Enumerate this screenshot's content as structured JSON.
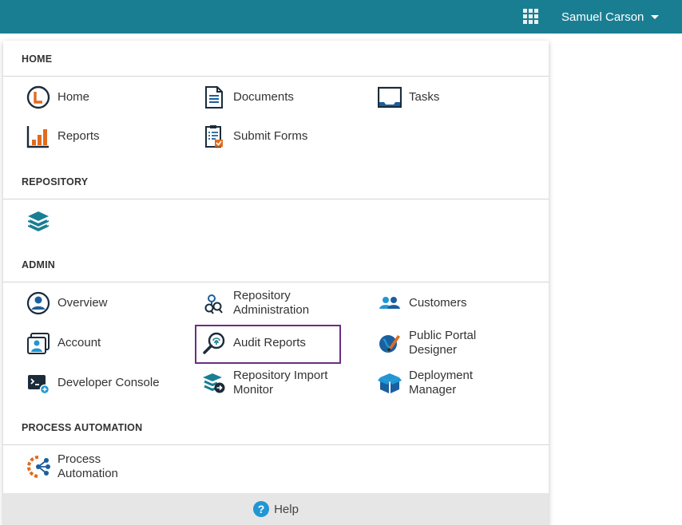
{
  "header": {
    "user_name": "Samuel Carson",
    "apps_icon": "apps-grid-icon",
    "bar_color": "#1a7e93"
  },
  "menu": {
    "sections": {
      "home": {
        "title": "HOME",
        "items": [
          {
            "label": "Home",
            "icon": "home-icon"
          },
          {
            "label": "Documents",
            "icon": "documents-icon"
          },
          {
            "label": "Tasks",
            "icon": "tasks-icon"
          },
          {
            "label": "Reports",
            "icon": "reports-icon"
          },
          {
            "label": "Submit Forms",
            "icon": "submit-forms-icon"
          }
        ]
      },
      "repository": {
        "title": "REPOSITORY",
        "items": [
          {
            "label": "",
            "icon": "repository-layers-icon"
          }
        ]
      },
      "admin": {
        "title": "ADMIN",
        "items": [
          {
            "label": "Overview",
            "icon": "overview-icon"
          },
          {
            "label": "Repository\nAdministration",
            "icon": "repository-admin-icon"
          },
          {
            "label": "Customers",
            "icon": "customers-icon"
          },
          {
            "label": "Account",
            "icon": "account-icon"
          },
          {
            "label": "Audit Reports",
            "icon": "audit-reports-icon"
          },
          {
            "label": "Public Portal\nDesigner",
            "icon": "public-portal-icon"
          },
          {
            "label": "Developer Console",
            "icon": "developer-console-icon"
          },
          {
            "label": "Repository Import\nMonitor",
            "icon": "import-monitor-icon"
          },
          {
            "label": "Deployment\nManager",
            "icon": "deployment-manager-icon"
          }
        ]
      },
      "process_automation": {
        "title": "PROCESS AUTOMATION",
        "items": [
          {
            "label": "Process\nAutomation",
            "icon": "process-automation-icon"
          }
        ]
      }
    },
    "help": {
      "label": "Help",
      "icon": "help-icon"
    }
  },
  "colors": {
    "accent": "#1a7e93",
    "highlight": "#6a2f84",
    "orange": "#e06b1f",
    "blue": "#1b5f9e"
  }
}
